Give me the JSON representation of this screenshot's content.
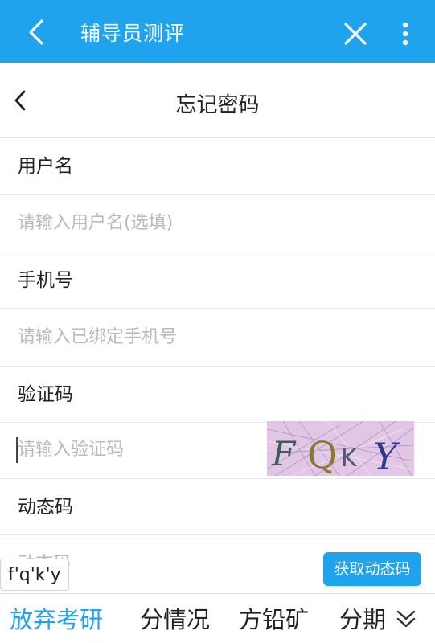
{
  "appbar": {
    "title": "辅导员测评",
    "back_icon": "back-arrow-icon",
    "close_icon": "close-icon",
    "more_icon": "more-vertical-icon",
    "color": "#1fa3ec"
  },
  "page": {
    "title": "忘记密码",
    "back_icon": "back-arrow-icon"
  },
  "form": {
    "username_label": "用户名",
    "username_placeholder": "请输入用户名(选填)",
    "phone_label": "手机号",
    "phone_placeholder": "请输入已绑定手机号",
    "captcha_label": "验证码",
    "captcha_placeholder": "请输入验证码",
    "captcha_image_text": "FQKY",
    "dynamic_label": "动态码",
    "dynamic_placeholder": "动态码",
    "get_code_button": "获取动态码"
  },
  "ime": {
    "composing_text": "f'q'k'y",
    "candidates": [
      "放弃考研",
      "分情况",
      "方铅矿",
      "分期"
    ],
    "expand_icon": "chevron-double-down-icon"
  }
}
